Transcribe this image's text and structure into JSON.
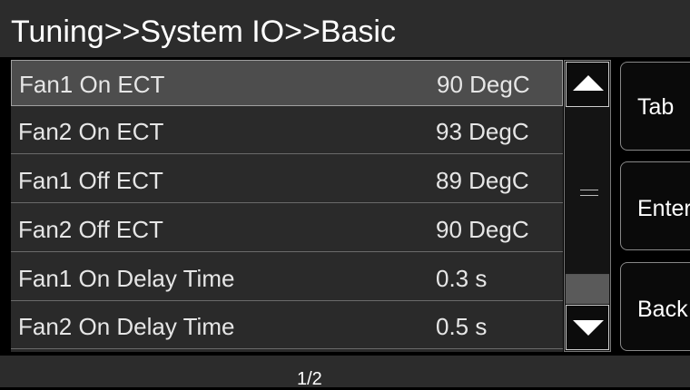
{
  "header": {
    "title": "Tuning>>System IO>>Basic"
  },
  "list": {
    "rows": [
      {
        "label": "Fan1 On ECT",
        "value": "90  DegC",
        "selected": true
      },
      {
        "label": "Fan2 On ECT",
        "value": "93  DegC",
        "selected": false
      },
      {
        "label": "Fan1 Off ECT",
        "value": "89  DegC",
        "selected": false
      },
      {
        "label": "Fan2 Off ECT",
        "value": "90  DegC",
        "selected": false
      },
      {
        "label": "Fan1 On Delay Time",
        "value": "0.3 s",
        "selected": false
      },
      {
        "label": "Fan2 On Delay Time",
        "value": "0.5 s",
        "selected": false
      }
    ]
  },
  "scrollbar": {
    "up_icon": "arrow-up-icon",
    "down_icon": "arrow-down-icon",
    "grip_icon": "grip-icon"
  },
  "side_buttons": {
    "tab_label": "Tab",
    "enter_label": "Enter",
    "back_label": "Back"
  },
  "footer": {
    "page": "1/2"
  },
  "colors": {
    "background": "#000000",
    "title_bar": "#2c2c2c",
    "list_bg": "#2a2a2a",
    "selected_row": "#4d4d4d",
    "text": "#e6e6e6"
  }
}
